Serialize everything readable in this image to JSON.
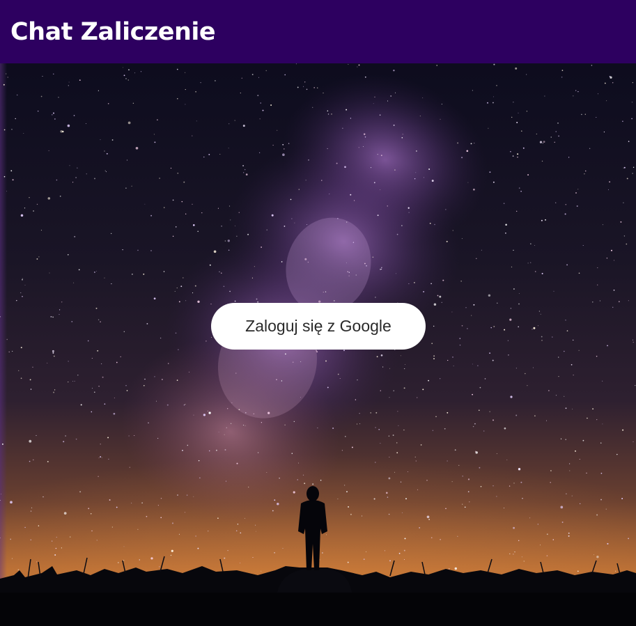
{
  "header": {
    "title": "Chat Zaliczenie"
  },
  "login": {
    "button_label": "Zaloguj się z Google"
  },
  "background": {
    "description_icon": "starry-night-photo",
    "colors": {
      "header": "#2d0060",
      "sky_top": "#0d0c1e",
      "milky_way": "#8a5aa8",
      "horizon_glow": "#c0733a",
      "ground": "#05060a",
      "button_bg": "#ffffff",
      "button_text": "#2a2a2a"
    }
  }
}
